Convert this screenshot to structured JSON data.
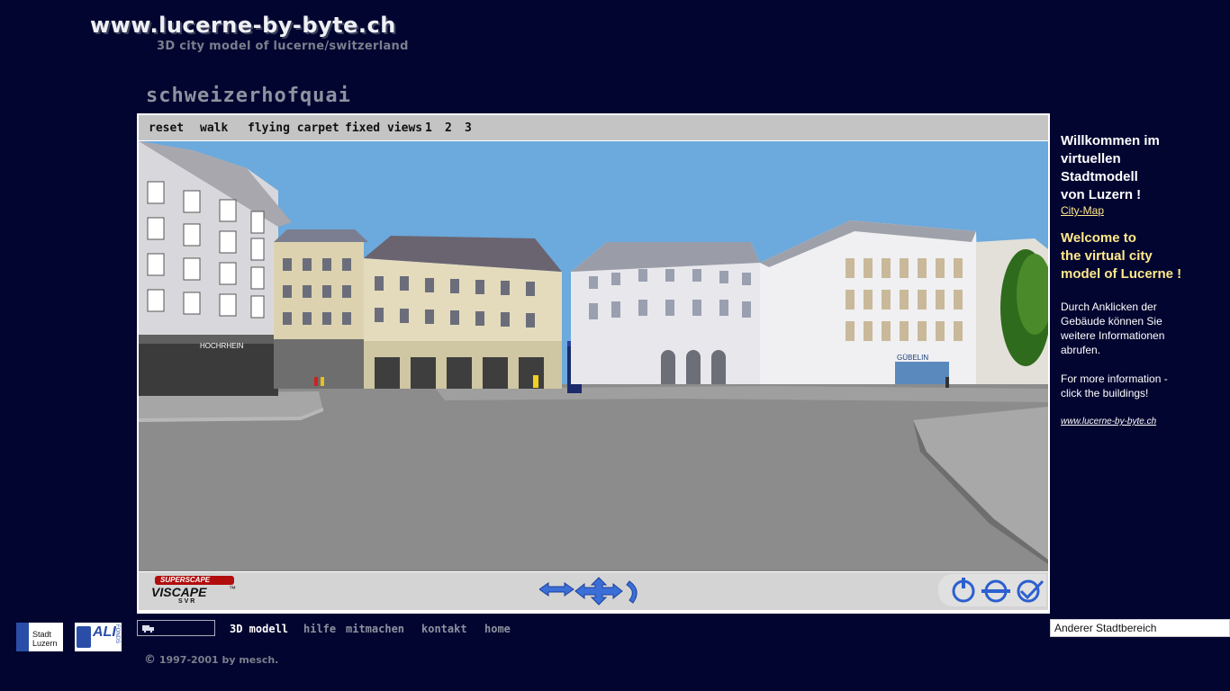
{
  "site": {
    "title": "www.lucerne-by-byte.ch",
    "subtitle": "3D city model of lucerne/switzerland"
  },
  "page_heading": "schweizerhofquai",
  "viewer_toolbar": {
    "reset": "reset",
    "walk": "walk",
    "flying_carpet": "flying carpet",
    "fixed_views": "fixed views",
    "views": [
      "1",
      "2",
      "3"
    ]
  },
  "scene": {
    "sign_hochrhein": "HOCHRHEIN",
    "sign_gubelin": "GÜBELIN"
  },
  "controls": {
    "logo_top": "SUPERSCAPE",
    "logo_main": "VISCAPE",
    "logo_tm": "™",
    "logo_bottom": "S V R",
    "nav_icons": [
      "pan-icon",
      "move-icon",
      "rotate-icon"
    ],
    "right_icons": [
      "power-icon",
      "zoom-icon",
      "confirm-icon"
    ]
  },
  "right_panel": {
    "welcome_de": [
      "Willkommen  im",
      "virtuellen",
      "Stadtmodell",
      "von Luzern !"
    ],
    "citymap_link": "City-Map",
    "welcome_en": [
      "Welcome to",
      "the virtual city",
      "model of Lucerne !"
    ],
    "info_de": [
      "Durch Anklicken der",
      "Gebäude können Sie",
      "weitere Informationen",
      "abrufen."
    ],
    "info_en": [
      "For more information  -",
      "click the buildings!"
    ],
    "footer_link": "www.lucerne-by-byte.ch"
  },
  "bottom_nav": {
    "items": [
      "3D modell",
      "hilfe",
      "mitmachen",
      "kontakt",
      "home"
    ]
  },
  "logos": {
    "stadt_line1": "Stadt",
    "stadt_line2": "Luzern",
    "ali_label": "ALI",
    "ali_side": "FONDS"
  },
  "copyright": "1997-2001 by mesch.",
  "district_select": {
    "value": "Anderer Stadtbereich"
  },
  "colors": {
    "background": "#020530",
    "sky": "#6aa8dc",
    "link": "#ffe98a"
  }
}
